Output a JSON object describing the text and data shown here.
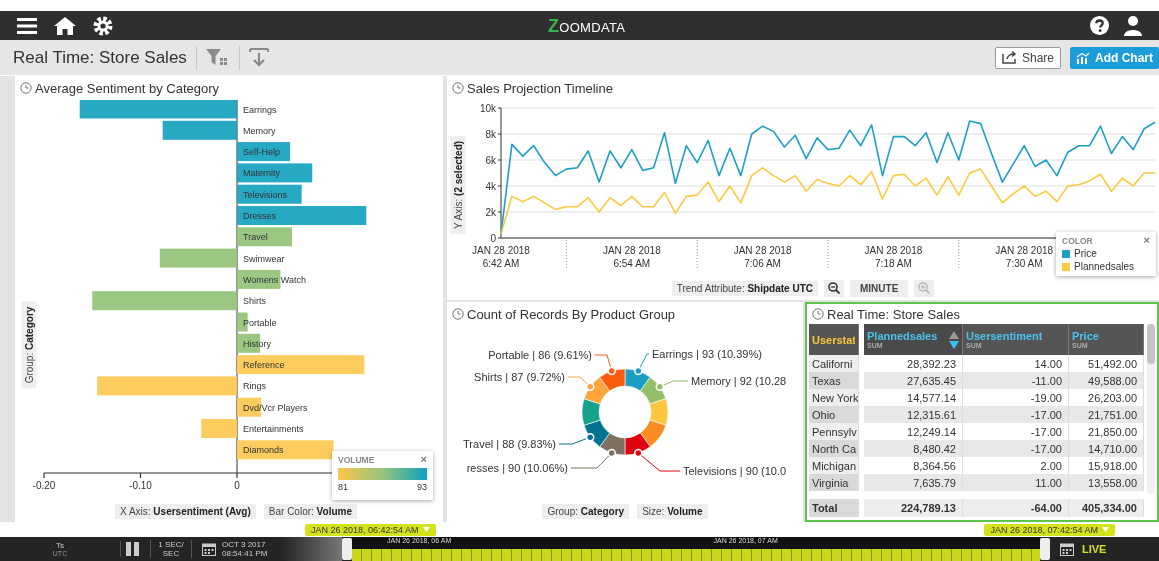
{
  "app_bar": {
    "logo": "ZOOMDATA"
  },
  "dashboard_bar": {
    "title": "Real Time: Store Sales",
    "share_label": "Share",
    "add_chart_label": "Add Chart"
  },
  "sentiment_panel": {
    "title": "Average Sentiment by Category",
    "y_axis_pill": "Group: **Category**",
    "x_axis_pill": "X Axis: **Usersentiment (Avg)**",
    "color_pill": "Bar Color: **Volume**",
    "legend": {
      "title": "VOLUME",
      "close": "×",
      "min": "81",
      "max": "93"
    },
    "chart_data": {
      "type": "bar",
      "orientation": "horizontal",
      "categories": [
        "Earrings",
        "Memory",
        "Self-Help",
        "Maternity",
        "Televisions",
        "Dresses",
        "Travel",
        "Swimwear",
        "Womens Watch",
        "Shirts",
        "Portable",
        "History",
        "Reference",
        "Rings",
        "Dvd/Vcr Players",
        "Entertainments",
        "Diamonds"
      ],
      "values": [
        -0.163,
        -0.077,
        0.055,
        0.078,
        0.067,
        0.134,
        0.057,
        -0.08,
        0.045,
        -0.15,
        0.011,
        0.024,
        0.132,
        -0.145,
        0.025,
        -0.037,
        0.1
      ],
      "colors": [
        "#1ba3c0",
        "#1ba3c0",
        "#1ba3c0",
        "#1ba3c0",
        "#1ba3c0",
        "#1ba3c0",
        "#96c47c",
        "#96c47c",
        "#96c47c",
        "#96c47c",
        "#96c47c",
        "#96c47c",
        "#fcc955",
        "#fcc955",
        "#fcc955",
        "#fcc955",
        "#fcc955"
      ],
      "xlim": [
        -0.2,
        0.2
      ],
      "xticks": [
        {
          "value": -0.2,
          "label": "-0.20"
        },
        {
          "value": -0.1,
          "label": "-0.10"
        },
        {
          "value": 0,
          "label": "0"
        }
      ]
    }
  },
  "timeline_panel": {
    "title": "Sales Projection Timeline",
    "y_axis_pill": "Y Axis: **(2 selected)**",
    "trend_pill": "Trend Attribute: **Shipdate UTC**",
    "interval": "MINUTE",
    "legend_title": "COLOR",
    "legend_close": "×",
    "chart_data": {
      "type": "line",
      "grid": true,
      "categories": [
        "JAN 28 2018\n6:42 AM",
        null,
        null,
        null,
        null,
        null,
        null,
        null,
        null,
        null,
        null,
        null,
        "JAN 28 2018\n6:54 AM",
        null,
        null,
        null,
        null,
        null,
        null,
        null,
        null,
        null,
        null,
        null,
        "JAN 28 2018\n7:06 AM",
        null,
        null,
        null,
        null,
        null,
        null,
        null,
        null,
        null,
        null,
        null,
        "JAN 28 2018\n7:18 AM",
        null,
        null,
        null,
        null,
        null,
        null,
        null,
        null,
        null,
        null,
        null,
        "JAN 28 2018\n7:30 AM",
        null,
        null,
        null,
        null,
        null,
        null,
        null,
        null,
        null,
        null,
        null,
        null
      ],
      "ylim": [
        0,
        10000
      ],
      "yticks": [
        {
          "value": 0,
          "label": "0"
        },
        {
          "value": 2000,
          "label": "2k"
        },
        {
          "value": 4000,
          "label": "4k"
        },
        {
          "value": 6000,
          "label": "6k"
        },
        {
          "value": 8000,
          "label": "8k"
        },
        {
          "value": 10000,
          "label": "10k"
        }
      ],
      "series": [
        {
          "name": "Price",
          "color": "#1b9fc4",
          "values": [
            300,
            7200,
            6300,
            7100,
            5800,
            4800,
            5300,
            5400,
            6700,
            4300,
            6700,
            5400,
            6800,
            5200,
            5400,
            8100,
            4200,
            7100,
            5800,
            7500,
            4800,
            6900,
            4800,
            8000,
            8600,
            8200,
            7000,
            7900,
            6100,
            7700,
            6800,
            6900,
            8300,
            7100,
            8700,
            4800,
            7800,
            7800,
            7100,
            8100,
            5800,
            8100,
            6000,
            9000,
            8800,
            6500,
            4300,
            5700,
            7100,
            5500,
            6000,
            4800,
            6600,
            7100,
            7100,
            8600,
            6500,
            7800,
            6800,
            8400,
            8900
          ]
        },
        {
          "name": "Plannedsales",
          "color": "#fcc93e",
          "values": [
            300,
            3200,
            2800,
            3200,
            2700,
            2200,
            2400,
            2400,
            3100,
            2000,
            3100,
            2500,
            3200,
            2400,
            2400,
            3500,
            1900,
            3200,
            3300,
            4300,
            2800,
            4000,
            2700,
            4800,
            5400,
            4800,
            4300,
            4800,
            3600,
            4500,
            4200,
            4000,
            4800,
            4100,
            5100,
            3000,
            4800,
            4900,
            4000,
            4600,
            3300,
            4700,
            3300,
            5000,
            5300,
            4000,
            2700,
            3400,
            4000,
            3200,
            3600,
            2800,
            4000,
            4100,
            4400,
            4900,
            3600,
            4600,
            4000,
            5000,
            5000
          ]
        }
      ]
    }
  },
  "donut_panel": {
    "title": "Count of Records By Product Group",
    "group_pill": "Group: **Category**",
    "size_pill": "Size: **Volume**",
    "labels": [
      {
        "text": "Portable | 86 (9.61%)",
        "color": "#fc5a0c"
      },
      {
        "text": "Earrings | 93 (10.39%)",
        "color": "#1a9ec2"
      },
      {
        "text": "Shirts | 87 (9.72%)",
        "color": "#fda63c"
      },
      {
        "text": "Memory | 92 (10.28",
        "color": "#94be6a"
      },
      {
        "text": "Travel | 88 (9.83%)",
        "color": "#01728f"
      },
      {
        "text": "resses | 90 (10.06%)",
        "color": "#7d705e"
      },
      {
        "text": "Televisions | 90 (10.0",
        "color": "#e1000f"
      }
    ],
    "slices": [
      {
        "color": "#1a9ec2"
      },
      {
        "color": "#94be6a"
      },
      {
        "color": "#fcc63e"
      },
      {
        "color": "#f98c22"
      },
      {
        "color": "#e1000f"
      },
      {
        "color": "#7d705e"
      },
      {
        "color": "#01728f"
      },
      {
        "color": "#17a28d"
      },
      {
        "color": "#fda63c"
      },
      {
        "color": "#fc5a0c"
      }
    ]
  },
  "table_panel": {
    "title": "Real Time: Store Sales",
    "selected": true,
    "columns": [
      {
        "title": "Userstat",
        "sorted": false
      },
      {
        "title": "Plannedsales",
        "subtitle": "SUM",
        "sorted": true
      },
      {
        "title": "Usersentiment",
        "subtitle": "SUM",
        "sorted": false
      },
      {
        "title": "Price",
        "subtitle": "SUM",
        "sorted": false
      }
    ],
    "rows": [
      {
        "cells": [
          "Californi",
          "28,392.23",
          "14.00",
          "51,492.00"
        ]
      },
      {
        "cells": [
          "Texas",
          "27,635.45",
          "-11.00",
          "49,588.00"
        ]
      },
      {
        "cells": [
          "New York",
          "14,577.14",
          "-19.00",
          "26,203.00"
        ]
      },
      {
        "cells": [
          "Ohio",
          "12,315.61",
          "-17.00",
          "21,751.00"
        ]
      },
      {
        "cells": [
          "Pennsylv",
          "12,249.14",
          "-17.00",
          "21,850.00"
        ]
      },
      {
        "cells": [
          "North Ca",
          "8,480.42",
          "-17.00",
          "14,710.00"
        ]
      },
      {
        "cells": [
          "Michigan",
          "8,364.56",
          "2.00",
          "15,918.00"
        ]
      },
      {
        "cells": [
          "Virginia",
          "7,635.79",
          "11.00",
          "13,558.00"
        ]
      }
    ],
    "total": {
      "cells": [
        "Total",
        "224,789.13",
        "-64.00",
        "405,334.00"
      ]
    }
  },
  "time_bar": {
    "start_label": "JAN 26 2018, 06:42:54 AM",
    "end_label": "JAN 26 2018, 07:42:54 AM",
    "timezone": "Ts",
    "timezone_sub": "UTC",
    "rate": "1 SEC/",
    "rate_sub": "SEC",
    "date": "OCT 3 2017",
    "time": "08:54:41 PM",
    "track_labels": [
      "JAN 26 2018, 06 AM",
      "JAN 26 2018, 07 AM"
    ],
    "live": "LIVE"
  }
}
